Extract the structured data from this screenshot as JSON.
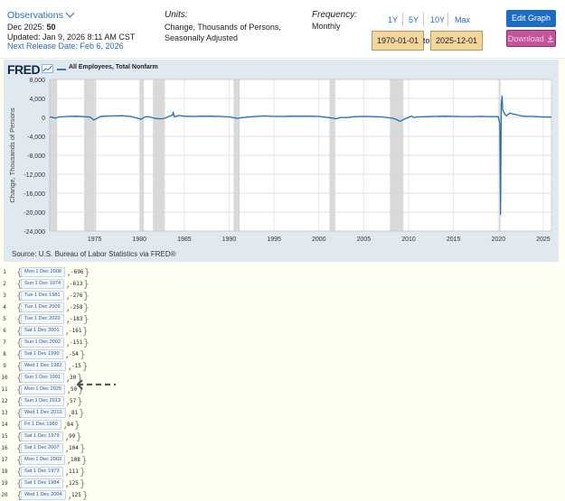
{
  "header": {
    "observations_label": "Observations",
    "observation_date": "Dec 2025:",
    "observation_value": "50",
    "updated": "Updated: Jan 9, 2026 8:11 AM CST",
    "next_release": "Next Release Date: Feb 6, 2026",
    "units_heading": "Units:",
    "units_line1": "Change, Thousands of Persons,",
    "units_line2": "Seasonally Adjusted",
    "frequency_heading": "Frequency:",
    "frequency_value": "Monthly",
    "ranges": [
      "1Y",
      "5Y",
      "10Y",
      "Max"
    ],
    "start_date": "1970-01-01",
    "to_label": "to",
    "end_date": "2025-12-01",
    "edit_graph": "Edit Graph",
    "download": "Download"
  },
  "chart_data": {
    "type": "line",
    "logo": "FRED",
    "legend": "All Employees, Total Nonfarm",
    "ylabel": "Change, Thousands of Persons",
    "ylim": [
      -24000,
      8000
    ],
    "yticks": [
      "8,000",
      "4,000",
      "0",
      "-4,000",
      "-8,000",
      "-12,000",
      "-16,000",
      "-20,000",
      "-24,000"
    ],
    "xlim": [
      1970,
      2025.92
    ],
    "xticks": [
      "1975",
      "1980",
      "1985",
      "1990",
      "1995",
      "2000",
      "2005",
      "2010",
      "2015",
      "2020",
      "2025"
    ],
    "recessions": [
      [
        1969.92,
        1970.83
      ],
      [
        1973.83,
        1975.17
      ],
      [
        1980.0,
        1980.5
      ],
      [
        1981.5,
        1982.83
      ],
      [
        1990.5,
        1991.17
      ],
      [
        2001.17,
        2001.83
      ],
      [
        2007.92,
        2009.42
      ],
      [
        2020.08,
        2020.25
      ]
    ],
    "series": [
      {
        "name": "All Employees, Total Nonfarm",
        "points": [
          [
            1970.0,
            100
          ],
          [
            1970.7,
            -150
          ],
          [
            1971.0,
            80
          ],
          [
            1972.0,
            200
          ],
          [
            1973.0,
            250
          ],
          [
            1974.5,
            50
          ],
          [
            1974.9,
            -550
          ],
          [
            1975.2,
            -300
          ],
          [
            1975.6,
            150
          ],
          [
            1976.0,
            250
          ],
          [
            1977.0,
            300
          ],
          [
            1978.0,
            350
          ],
          [
            1979.0,
            200
          ],
          [
            1980.2,
            -400
          ],
          [
            1980.6,
            100
          ],
          [
            1981.0,
            150
          ],
          [
            1981.8,
            -250
          ],
          [
            1982.4,
            -300
          ],
          [
            1982.8,
            -200
          ],
          [
            1983.3,
            200
          ],
          [
            1983.7,
            500
          ],
          [
            1983.75,
            1100
          ],
          [
            1983.9,
            100
          ],
          [
            1984.4,
            400
          ],
          [
            1985.0,
            250
          ],
          [
            1986.0,
            200
          ],
          [
            1987.0,
            250
          ],
          [
            1988.0,
            250
          ],
          [
            1989.0,
            200
          ],
          [
            1990.0,
            100
          ],
          [
            1990.9,
            -200
          ],
          [
            1991.3,
            -100
          ],
          [
            1992.0,
            50
          ],
          [
            1993.0,
            200
          ],
          [
            1994.0,
            300
          ],
          [
            1995.0,
            200
          ],
          [
            1996.0,
            200
          ],
          [
            1997.0,
            250
          ],
          [
            1998.0,
            250
          ],
          [
            1999.0,
            250
          ],
          [
            2000.0,
            200
          ],
          [
            2001.5,
            -150
          ],
          [
            2001.9,
            -300
          ],
          [
            2002.5,
            0
          ],
          [
            2003.0,
            -50
          ],
          [
            2004.0,
            150
          ],
          [
            2005.0,
            200
          ],
          [
            2006.0,
            150
          ],
          [
            2007.0,
            100
          ],
          [
            2008.3,
            -200
          ],
          [
            2008.7,
            -500
          ],
          [
            2008.95,
            -800
          ],
          [
            2009.2,
            -700
          ],
          [
            2009.5,
            -400
          ],
          [
            2009.9,
            -100
          ],
          [
            2010.3,
            300
          ],
          [
            2010.6,
            -50
          ],
          [
            2011.0,
            100
          ],
          [
            2012.0,
            150
          ],
          [
            2013.0,
            200
          ],
          [
            2014.0,
            250
          ],
          [
            2015.0,
            200
          ],
          [
            2016.0,
            180
          ],
          [
            2017.0,
            180
          ],
          [
            2018.0,
            200
          ],
          [
            2019.0,
            180
          ],
          [
            2020.0,
            150
          ],
          [
            2020.17,
            -1400
          ],
          [
            2020.25,
            -20500
          ],
          [
            2020.33,
            2700
          ],
          [
            2020.42,
            4500
          ],
          [
            2020.5,
            1500
          ],
          [
            2020.58,
            1200
          ],
          [
            2020.75,
            600
          ],
          [
            2020.92,
            300
          ],
          [
            2021.0,
            500
          ],
          [
            2021.3,
            900
          ],
          [
            2021.6,
            700
          ],
          [
            2021.9,
            600
          ],
          [
            2022.3,
            400
          ],
          [
            2022.8,
            250
          ],
          [
            2023.3,
            200
          ],
          [
            2023.8,
            200
          ],
          [
            2024.3,
            150
          ],
          [
            2024.8,
            100
          ],
          [
            2025.3,
            50
          ],
          [
            2025.92,
            50
          ]
        ]
      }
    ],
    "source": "Source: U.S. Bureau of Labor Statistics via FRED®"
  },
  "list": {
    "rows": [
      {
        "n": "1",
        "date": "Mon 1 Dec 2008",
        "value": "-696"
      },
      {
        "n": "2",
        "date": "Sun 1 Dec 1974",
        "value": "-613"
      },
      {
        "n": "3",
        "date": "Tue 1 Dec 1981",
        "value": "-276"
      },
      {
        "n": "4",
        "date": "Tue 1 Dec 2009",
        "value": "-258"
      },
      {
        "n": "5",
        "date": "Tue 1 Dec 2020",
        "value": "-183"
      },
      {
        "n": "6",
        "date": "Sat 1 Dec 2001",
        "value": "-161"
      },
      {
        "n": "7",
        "date": "Sun 1 Dec 2002",
        "value": "-151"
      },
      {
        "n": "8",
        "date": "Sat 1 Dec 1990",
        "value": "-54"
      },
      {
        "n": "9",
        "date": "Wed 1 Dec 1982",
        "value": "-15"
      },
      {
        "n": "10",
        "date": "Sun 1 Dec 1991",
        "value": "30"
      },
      {
        "n": "11",
        "date": "Mon 1 Dec 2025",
        "value": "50"
      },
      {
        "n": "12",
        "date": "Sun 1 Dec 2013",
        "value": "57"
      },
      {
        "n": "13",
        "date": "Wed 1 Dec 2010",
        "value": "81"
      },
      {
        "n": "14",
        "date": "Fri 1 Dec 1980",
        "value": "84"
      },
      {
        "n": "15",
        "date": "Sat 1 Dec 1979",
        "value": "99"
      },
      {
        "n": "16",
        "date": "Sat 1 Dec 2007",
        "value": "104"
      },
      {
        "n": "17",
        "date": "Mon 1 Dec 2003",
        "value": "108"
      },
      {
        "n": "18",
        "date": "Sat 1 Dec 1973",
        "value": "111"
      },
      {
        "n": "19",
        "date": "Sat 1 Dec 1984",
        "value": "125"
      },
      {
        "n": "20",
        "date": "Wed 1 Dec 2004",
        "value": "125"
      }
    ],
    "highlight_index": 10
  },
  "colors": {
    "link": "#2a6db0",
    "series": "#2c6fb0",
    "plot_bg": "#ffffff",
    "panel_bg": "#e1e9f0",
    "recession": "#d9d9d9",
    "date_box": "#f1d59e",
    "edit_btn": "#1c6cc4",
    "download_btn": "#c2559b"
  }
}
